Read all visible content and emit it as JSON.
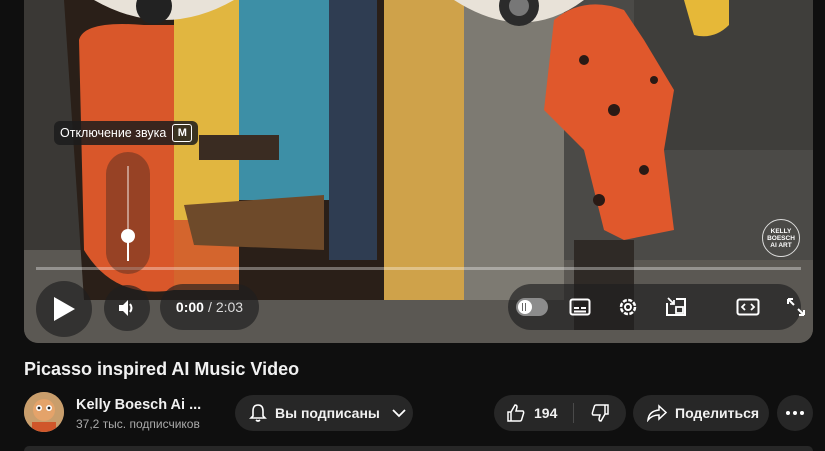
{
  "player": {
    "mute_tooltip": "Отключение звука",
    "mute_key": "M",
    "current_time": "0:00",
    "separator": "/",
    "duration": "2:03",
    "volume_level": 0.26,
    "progress": 0.0,
    "watermark_lines": [
      "KELLY",
      "BOESCH",
      "AI ART"
    ]
  },
  "video": {
    "title": "Picasso inspired AI Music Video"
  },
  "channel": {
    "name": "Kelly Boesch Ai ...",
    "subscribers": "37,2 тыс. подписчиков"
  },
  "actions": {
    "subscribed_label": "Вы подписаны",
    "like_count": "194",
    "share_label": "Поделиться"
  },
  "colors": {
    "background": "#0f0f0f",
    "pill": "#272727",
    "text": "#f1f1f1",
    "muted_text": "#aaaaaa"
  }
}
